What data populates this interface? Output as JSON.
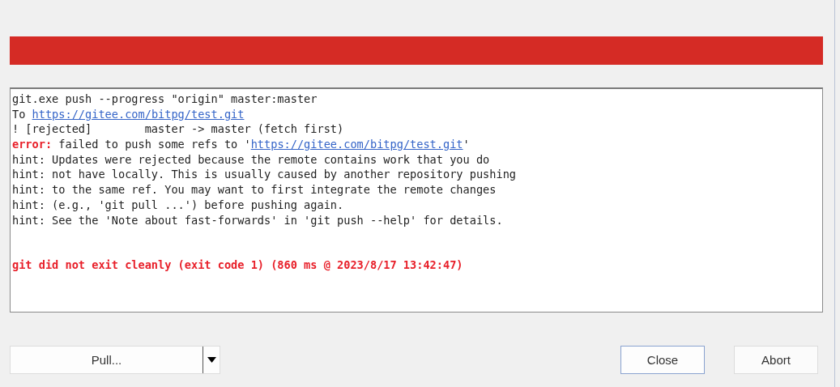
{
  "progress": {
    "level": 1,
    "failed": true
  },
  "log": {
    "lines": [
      {
        "kind": "text",
        "segments": [
          {
            "kind": "text",
            "text": "git.exe push --progress \"origin\" master:master"
          }
        ]
      },
      {
        "kind": "text",
        "segments": [
          {
            "kind": "text",
            "text": "To "
          },
          {
            "kind": "link",
            "text": "https://gitee.com/bitpg/test.git"
          }
        ]
      },
      {
        "kind": "text",
        "segments": [
          {
            "kind": "text",
            "text": "! [rejected]        master -> master (fetch first)"
          }
        ]
      },
      {
        "kind": "text",
        "segments": [
          {
            "kind": "error",
            "text": "error:"
          },
          {
            "kind": "text",
            "text": " failed to push some refs to '"
          },
          {
            "kind": "link",
            "text": "https://gitee.com/bitpg/test.git"
          },
          {
            "kind": "text",
            "text": "'"
          }
        ]
      },
      {
        "kind": "text",
        "segments": [
          {
            "kind": "text",
            "text": "hint: Updates were rejected because the remote contains work that you do"
          }
        ]
      },
      {
        "kind": "text",
        "segments": [
          {
            "kind": "text",
            "text": "hint: not have locally. This is usually caused by another repository pushing"
          }
        ]
      },
      {
        "kind": "text",
        "segments": [
          {
            "kind": "text",
            "text": "hint: to the same ref. You may want to first integrate the remote changes"
          }
        ]
      },
      {
        "kind": "text",
        "segments": [
          {
            "kind": "text",
            "text": "hint: (e.g., 'git pull ...') before pushing again."
          }
        ]
      },
      {
        "kind": "text",
        "segments": [
          {
            "kind": "text",
            "text": "hint: See the 'Note about fast-forwards' in 'git push --help' for details."
          }
        ]
      },
      {
        "kind": "status",
        "segments": [
          {
            "kind": "text",
            "text": "git did not exit cleanly (exit code 1) (860 ms @ 2023/8/17 13:42:47)"
          }
        ]
      }
    ]
  },
  "buttons": {
    "pull": {
      "label": "Pull..."
    },
    "close": {
      "label": "Close",
      "default": true
    },
    "abort": {
      "label": "Abort",
      "default": false
    }
  }
}
